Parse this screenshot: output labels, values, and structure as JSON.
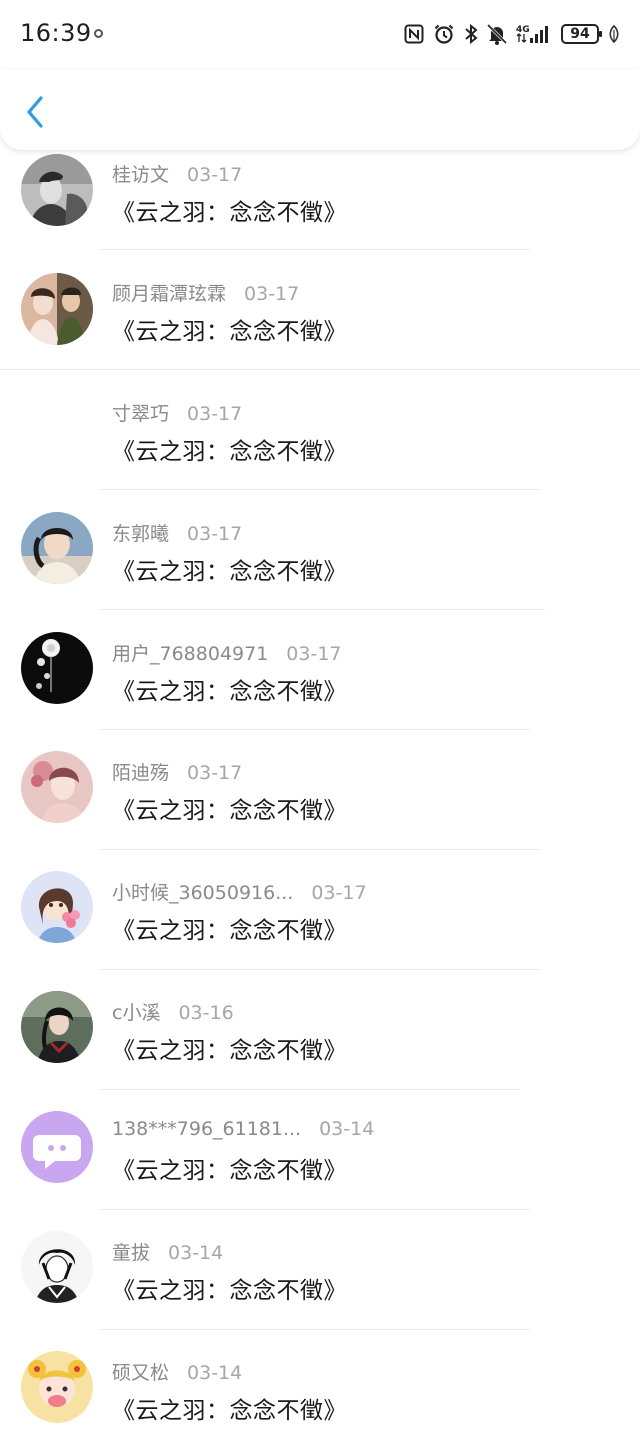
{
  "status_bar": {
    "time": "16:39",
    "network": "4G",
    "battery": "94"
  },
  "nav": {
    "back_icon": "chevron-left-icon"
  },
  "items": [
    {
      "name": "桂访文",
      "date": "03-17",
      "title": "《云之羽：念念不徵》",
      "avatar": "bw-portrait"
    },
    {
      "name": "顾月霜潭玹霖",
      "date": "03-17",
      "title": "《云之羽：念念不徵》",
      "avatar": "couple-photo"
    },
    {
      "name": "寸翠巧",
      "date": "03-17",
      "title": "《云之羽：念念不徵》",
      "avatar": "none"
    },
    {
      "name": "东郭曦",
      "date": "03-17",
      "title": "《云之羽：念念不徵》",
      "avatar": "girl-photo"
    },
    {
      "name": "用户_768804971",
      "date": "03-17",
      "title": "《云之羽：念念不徵》",
      "avatar": "dark-flower"
    },
    {
      "name": "陌迪殇",
      "date": "03-17",
      "title": "《云之羽：念念不徵》",
      "avatar": "pink-portrait"
    },
    {
      "name": "小时候_36050916...",
      "date": "03-17",
      "title": "《云之羽：念念不徵》",
      "avatar": "cartoon-girl"
    },
    {
      "name": "c小溪",
      "date": "03-16",
      "title": "《云之羽：念念不徵》",
      "avatar": "anime-boy"
    },
    {
      "name": "138***796_61181...",
      "date": "03-14",
      "title": "《云之羽：念念不徵》",
      "avatar": "default-purple"
    },
    {
      "name": "童拔",
      "date": "03-14",
      "title": "《云之羽：念念不徵》",
      "avatar": "sketch-boy"
    },
    {
      "name": "硕又松",
      "date": "03-14",
      "title": "《云之羽：念念不徵》",
      "avatar": "sailor-cartoon"
    }
  ],
  "colors": {
    "accent": "#2d9be0",
    "name_text": "#8a8a8a",
    "title_text": "#1a1a1a",
    "default_avatar": "#c9a6f0"
  }
}
